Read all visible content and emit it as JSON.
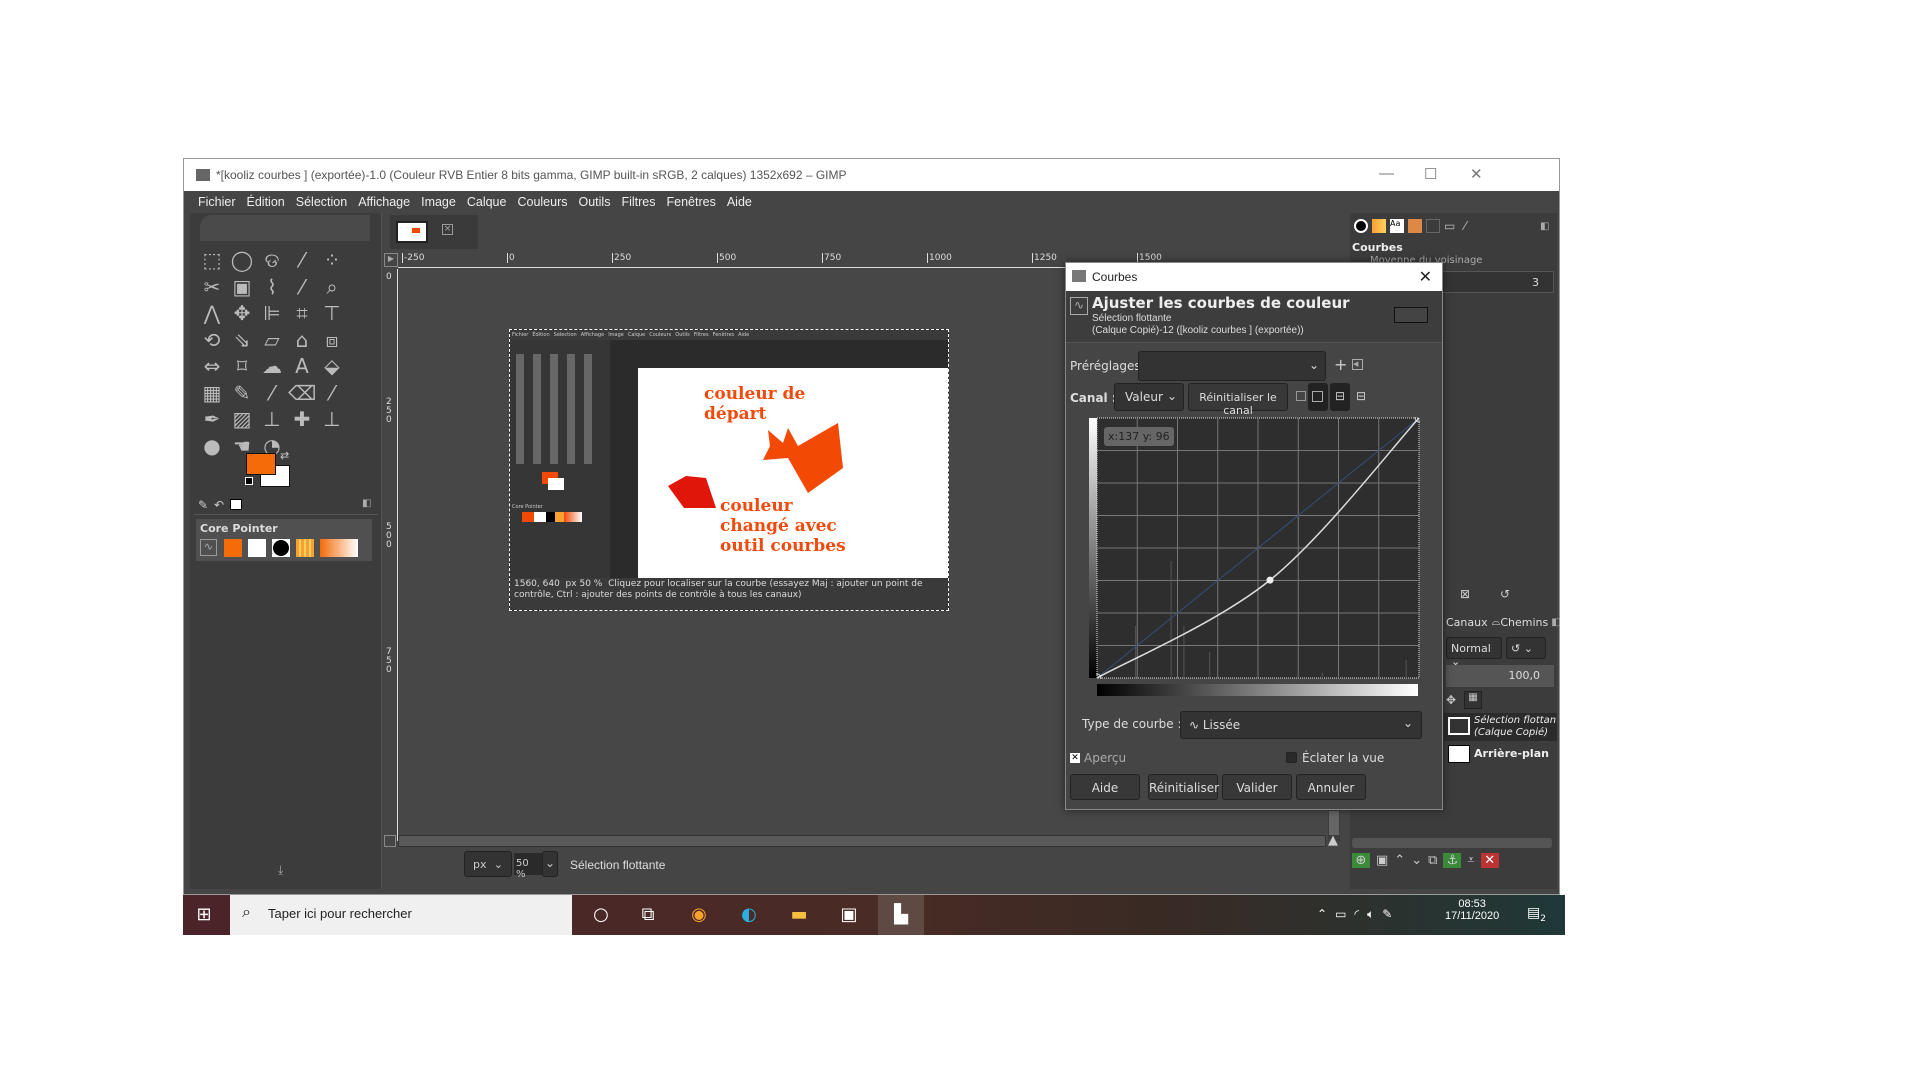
{
  "window": {
    "title": "*[kooliz courbes ] (exportée)-1.0 (Couleur RVB Entier 8 bits gamma, GIMP built-in sRGB, 2 calques) 1352x692 – GIMP",
    "minimize": "—",
    "maximize": "☐",
    "close": "✕"
  },
  "menu": [
    "Fichier",
    "Édition",
    "Sélection",
    "Affichage",
    "Image",
    "Calque",
    "Couleurs",
    "Outils",
    "Filtres",
    "Fenêtres",
    "Aide"
  ],
  "toolbox": {
    "tools": [
      "rect-select",
      "ellipse-select",
      "free-select",
      "fuzzy-select",
      "foreground-select",
      "scissors",
      "by-color-select",
      "paths",
      "color-picker",
      "zoom",
      "measure",
      "move",
      "align",
      "crop",
      "unified-transform",
      "rotate",
      "scale",
      "shear",
      "perspective",
      "3d-transform",
      "flip",
      "cage",
      "warp",
      "text",
      "bucket-fill",
      "gradient",
      "pencil",
      "paintbrush",
      "eraser",
      "airbrush",
      "ink",
      "mypaint",
      "clone",
      "heal",
      "perspective-clone",
      "blur",
      "smudge",
      "dodge-burn"
    ],
    "fg_color": "#f46b0a",
    "bg_color": "#ffffff",
    "tool_options_title": "Core Pointer"
  },
  "image_window": {
    "ruler_h": [
      "-250",
      "0",
      "250",
      "500",
      "750",
      "1000",
      "1250",
      "1500"
    ],
    "ruler_v": [
      "0",
      "250",
      "500",
      "750"
    ],
    "unit": "px",
    "zoom": "50 %",
    "status": "Sélection flottante"
  },
  "canvas_content": {
    "text1": [
      "couleur de",
      "départ"
    ],
    "text2": [
      "couleur",
      "changé avec",
      "outil courbes"
    ],
    "text_color": "#f24a0c",
    "shape1_color": "#f24a05",
    "shape2_color": "#e0160a",
    "inner_menu": [
      "Fichier",
      "Édition",
      "Sélection",
      "Affichage",
      "Image",
      "Calque",
      "Couleurs",
      "Outils",
      "Filtres",
      "Fenêtres",
      "Aide"
    ],
    "inner_tool_options": "Core Pointer",
    "inner_pointer": "1560, 640",
    "inner_unit": "px",
    "inner_zoom": "50 %",
    "inner_status": "Cliquez pour localiser sur la courbe (essayez Maj : ajouter un point de contrôle, Ctrl : ajouter des points de contrôle à tous les canaux)"
  },
  "dock": {
    "panel_title": "Courbes",
    "option_label": "Moyenne du voisinage",
    "option_value": "3",
    "layers_tabs": [
      "Canaux",
      "Chemins"
    ],
    "mode": "Normal",
    "opacity": "100,0",
    "layers": [
      {
        "name": "Sélection flottante",
        "sub": "(Calque Copié)",
        "floating": true
      },
      {
        "name": "Arrière-plan",
        "floating": false
      }
    ]
  },
  "dialog": {
    "title": "Courbes",
    "heading": "Ajuster les courbes de couleur",
    "sub1": "Sélection flottante",
    "sub2": "(Calque Copié)-12 ([kooliz courbes ] (exportée))",
    "presets_label": "Préréglages :",
    "presets_value": "",
    "channel_label": "Canal :",
    "channel_value": "Valeur",
    "reset_channel": "Réinitialiser le canal",
    "coords": "x:137 y: 96",
    "control_point": [
      137,
      96
    ],
    "curve_type_label": "Type de courbe :",
    "curve_type": "Lissée",
    "preview_label": "Aperçu",
    "preview_checked": true,
    "split_label": "Éclater la vue",
    "split_checked": false,
    "buttons": [
      "Aide",
      "Réinitialiser",
      "Valider",
      "Annuler"
    ]
  },
  "taskbar": {
    "search_placeholder": "Taper ici pour rechercher",
    "time": "08:53",
    "date": "17/11/2020",
    "notifications": "2"
  }
}
